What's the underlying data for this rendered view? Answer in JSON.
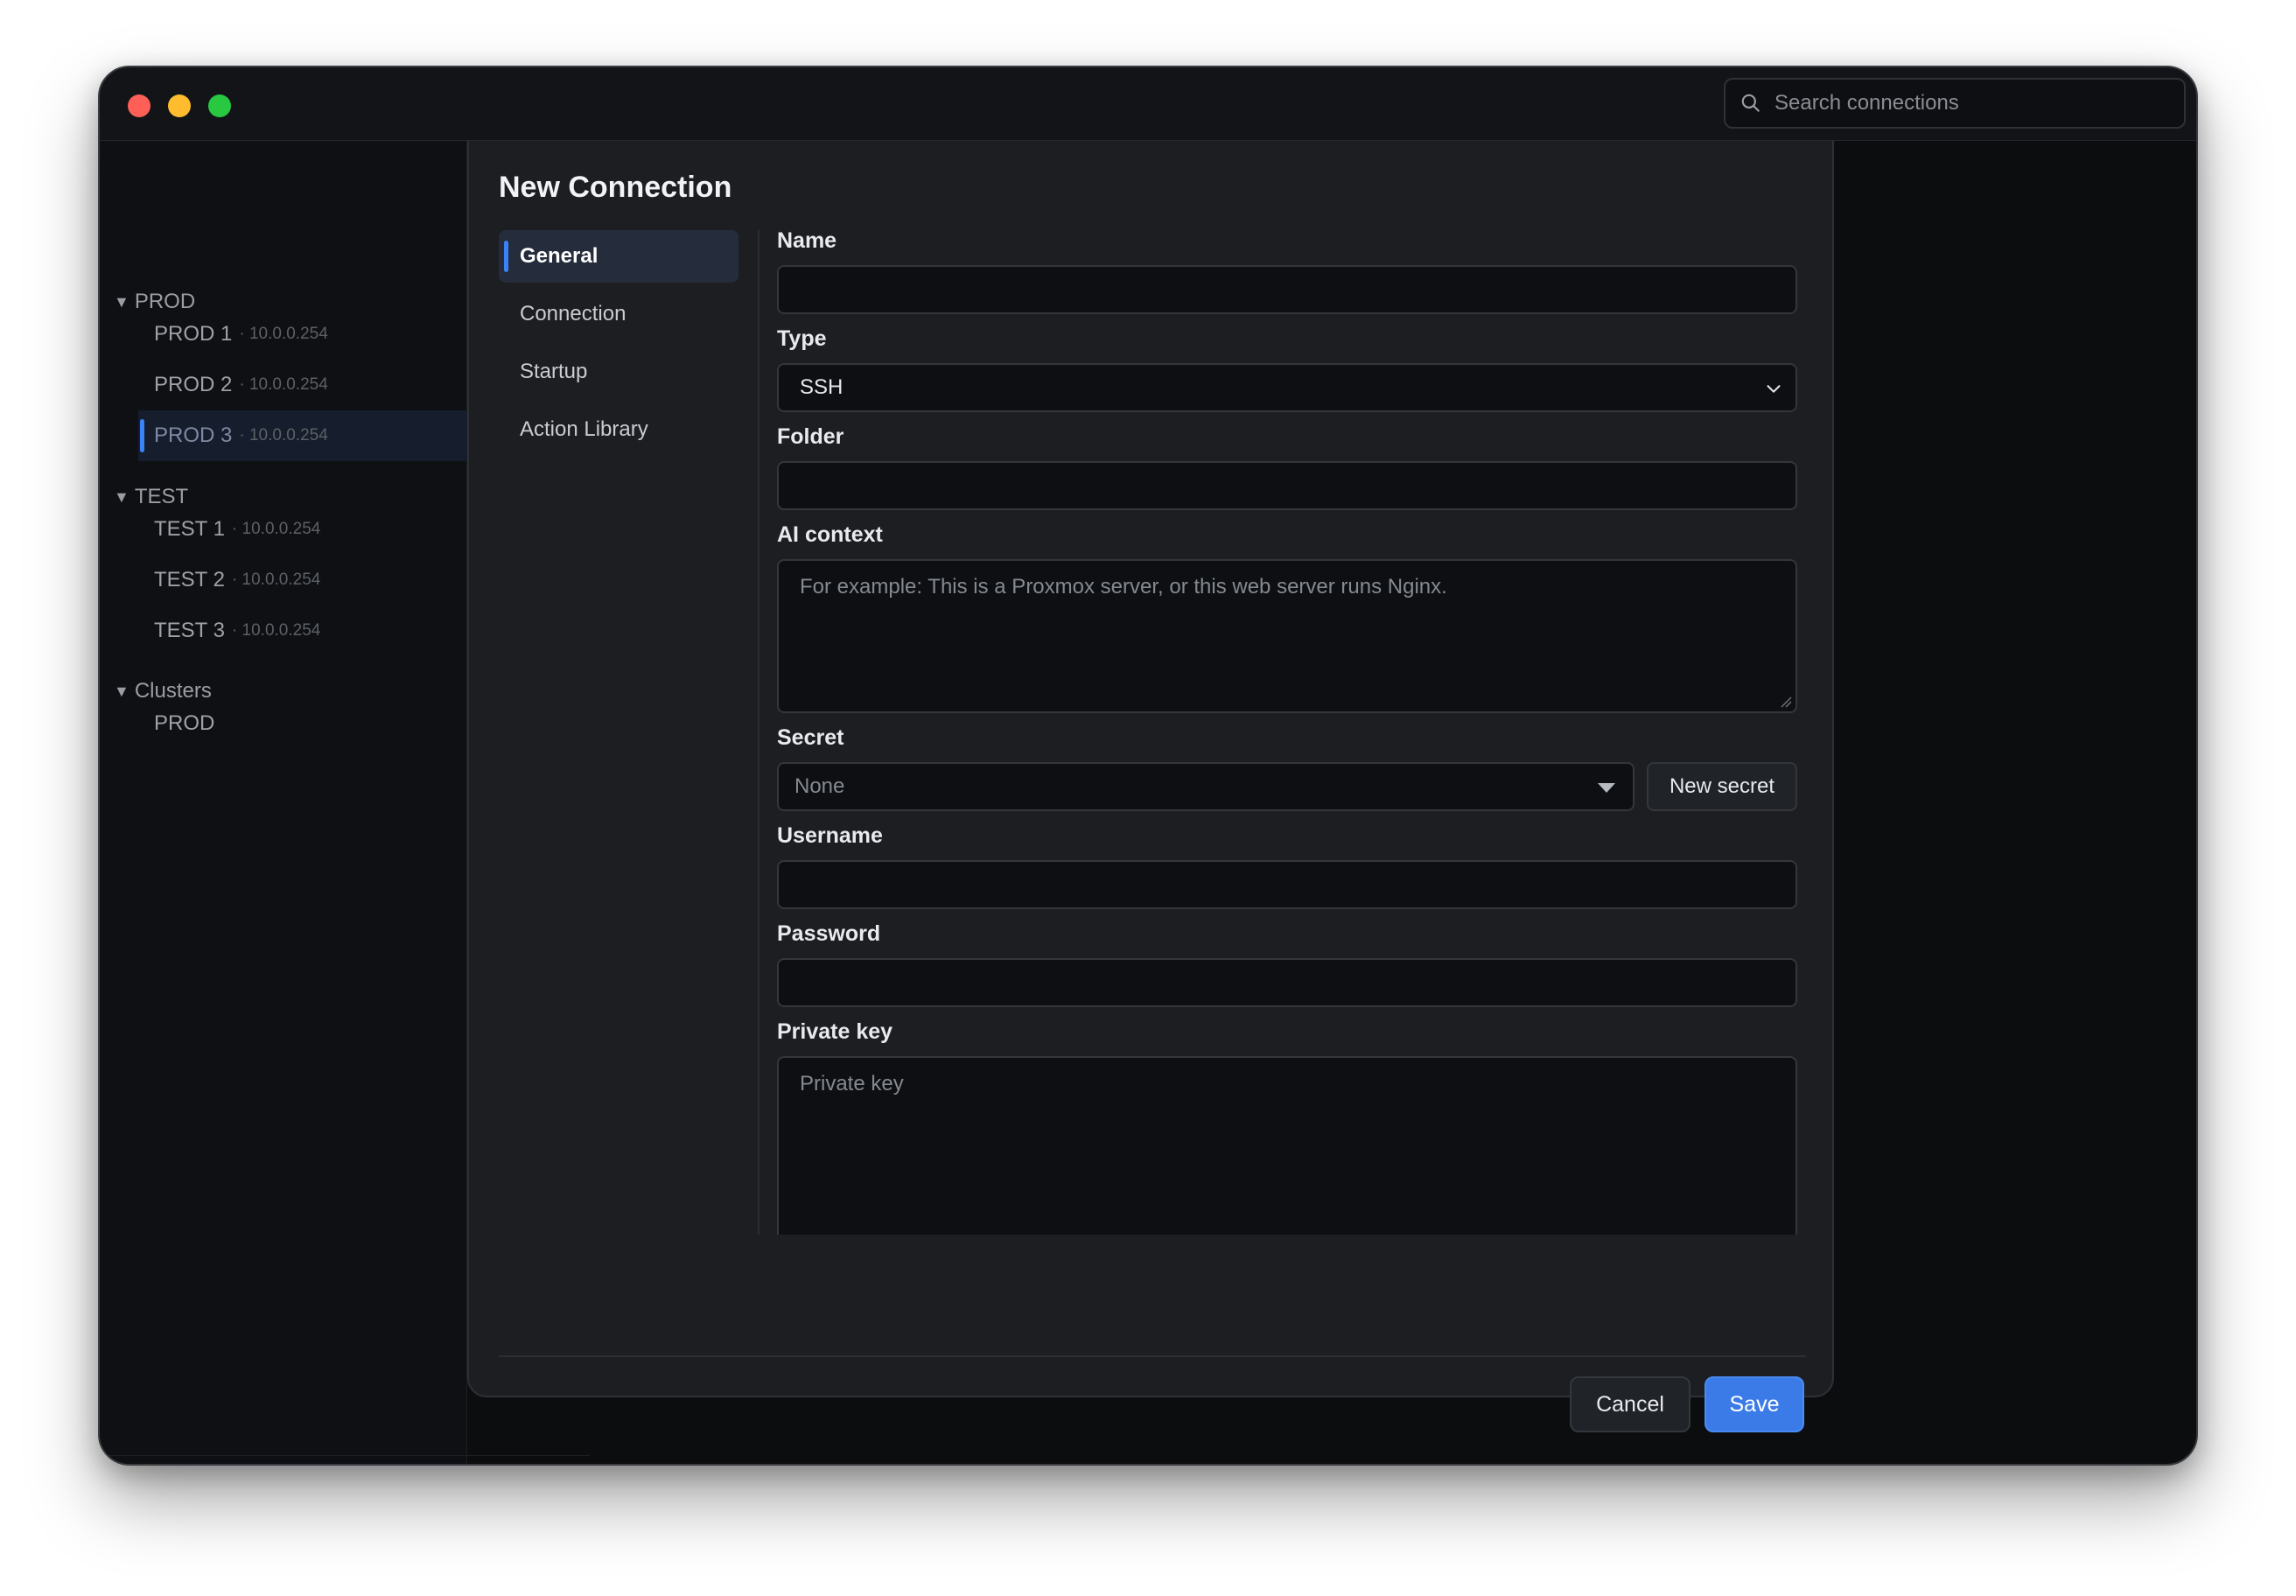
{
  "titlebar": {
    "search_placeholder": "Search connections"
  },
  "sidebar": {
    "groups": [
      {
        "label": "PROD",
        "items": [
          {
            "label": "PROD 1",
            "ip": "· 10.0.0.254"
          },
          {
            "label": "PROD 2",
            "ip": "· 10.0.0.254"
          },
          {
            "label": "PROD 3",
            "ip": "· 10.0.0.254",
            "selected": true
          }
        ]
      },
      {
        "label": "TEST",
        "items": [
          {
            "label": "TEST 1",
            "ip": "· 10.0.0.254"
          },
          {
            "label": "TEST 2",
            "ip": "· 10.0.0.254"
          },
          {
            "label": "TEST 3",
            "ip": "· 10.0.0.254"
          }
        ]
      },
      {
        "label": "Clusters",
        "items": [
          {
            "label": "PROD",
            "ip": ""
          }
        ]
      }
    ]
  },
  "modal": {
    "title": "New Connection",
    "nav": [
      "General",
      "Connection",
      "Startup",
      "Action Library"
    ],
    "active_nav": "General",
    "fields": {
      "name_label": "Name",
      "name_value": "",
      "type_label": "Type",
      "type_value": "SSH",
      "folder_label": "Folder",
      "folder_value": "",
      "ai_label": "AI context",
      "ai_placeholder": "For example: This is a Proxmox server, or this web server runs Nginx.",
      "secret_label": "Secret",
      "secret_value": "None",
      "new_secret_button": "New secret",
      "username_label": "Username",
      "username_value": "",
      "password_label": "Password",
      "password_value": "",
      "private_key_label": "Private key",
      "private_key_placeholder": "Private key"
    },
    "cancel_label": "Cancel",
    "save_label": "Save",
    "accent_color": "#3b7be8"
  },
  "toolbar": {
    "icons": [
      "sync-icon",
      "settings-icon",
      "add-icon",
      "add-folder-icon",
      "link-icon",
      "bookmark-icon",
      "terminal-icon"
    ],
    "sync_status_color": "#22c55e"
  }
}
